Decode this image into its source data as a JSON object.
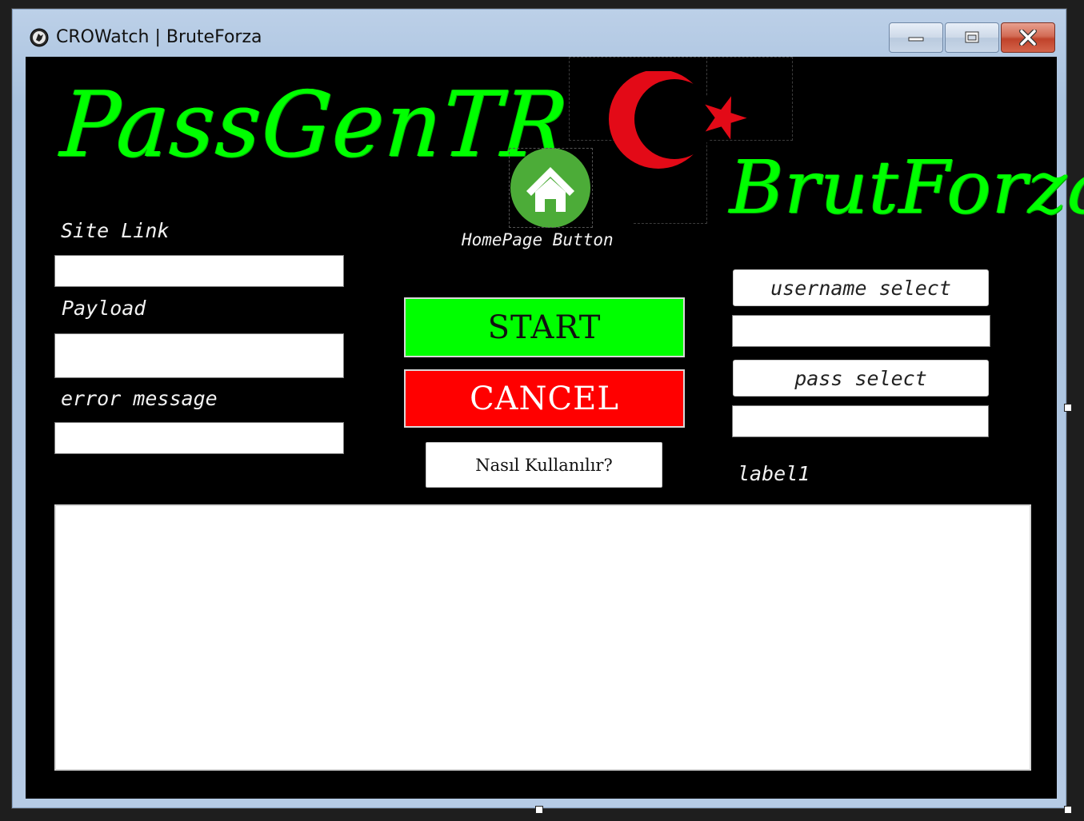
{
  "window": {
    "title": "CROWatch | BruteForza",
    "app_icon": "crow-app-icon",
    "controls": {
      "minimize_icon": "minimize-icon",
      "maximize_icon": "maximize-icon",
      "close_icon": "close-icon"
    }
  },
  "header": {
    "logo_left": "PassGenTR",
    "logo_right": "BrutForza",
    "flag_icon": "turkish-flag-icon",
    "home_button_icon": "home-icon",
    "home_button_label": "HomePage Button"
  },
  "form": {
    "site_link": {
      "label": "Site Link",
      "value": ""
    },
    "payload": {
      "label": "Payload",
      "value": ""
    },
    "error_message": {
      "label": "error message",
      "value": ""
    }
  },
  "actions": {
    "start_label": "START",
    "cancel_label": "CANCEL",
    "howto_label": "Nasıl Kullanılır?"
  },
  "selectors": {
    "username_select_label": "username select",
    "username_value": "",
    "pass_select_label": "pass select",
    "pass_value": "",
    "status_label": "label1"
  },
  "output": {
    "text": ""
  },
  "colors": {
    "background": "#000000",
    "logo_green": "#00ff00",
    "start_green": "#00ff00",
    "cancel_red": "#ff0000",
    "flag_red": "#e30a17"
  }
}
